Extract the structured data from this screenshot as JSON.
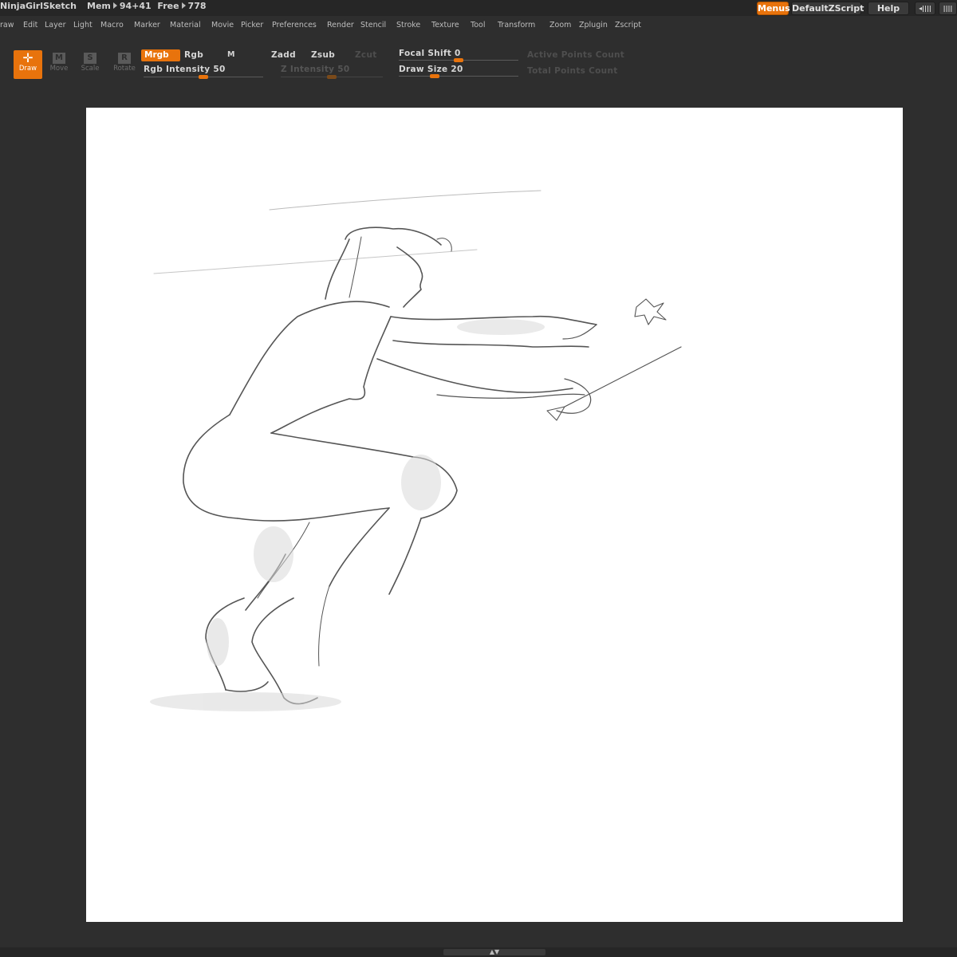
{
  "title": {
    "doc_name": "NinjaGirlSketch",
    "mem_label": "Mem",
    "mem_value": "94+41",
    "free_label": "Free",
    "free_value": "778",
    "menus_btn": "Menus",
    "script_btn": "DefaultZScript",
    "help_btn": "Help"
  },
  "menu": [
    "raw",
    "Edit",
    "Layer",
    "Light",
    "Macro",
    "Marker",
    "Material",
    "Movie",
    "Picker",
    "Preferences",
    "Render",
    "Stencil",
    "Stroke",
    "Texture",
    "Tool",
    "Transform",
    "Zoom",
    "Zplugin",
    "Zscript"
  ],
  "tools": {
    "draw": "Draw",
    "move": "Move",
    "scale": "Scale",
    "rotate": "Rotate",
    "move_glyph": "M",
    "scale_glyph": "S",
    "rotate_glyph": "R"
  },
  "brush": {
    "mrgb": "Mrgb",
    "rgb": "Rgb",
    "m": "M",
    "rgb_intensity_label": "Rgb Intensity",
    "rgb_intensity": "50",
    "rgb_intensity_frac": 0.5,
    "zadd": "Zadd",
    "zsub": "Zsub",
    "zcut": "Zcut",
    "z_intensity_label": "Z Intensity",
    "z_intensity": "50",
    "z_intensity_frac": 0.5,
    "focal_label": "Focal Shift",
    "focal_value": "0",
    "focal_frac": 0.5,
    "draw_size_label": "Draw Size",
    "draw_size": "20",
    "draw_size_frac": 0.3,
    "active_points": "Active Points Count",
    "total_points": "Total Points Count"
  },
  "colors": {
    "accent": "#e8730c",
    "bg": "#2e2e2e",
    "canvas": "#ffffff"
  }
}
